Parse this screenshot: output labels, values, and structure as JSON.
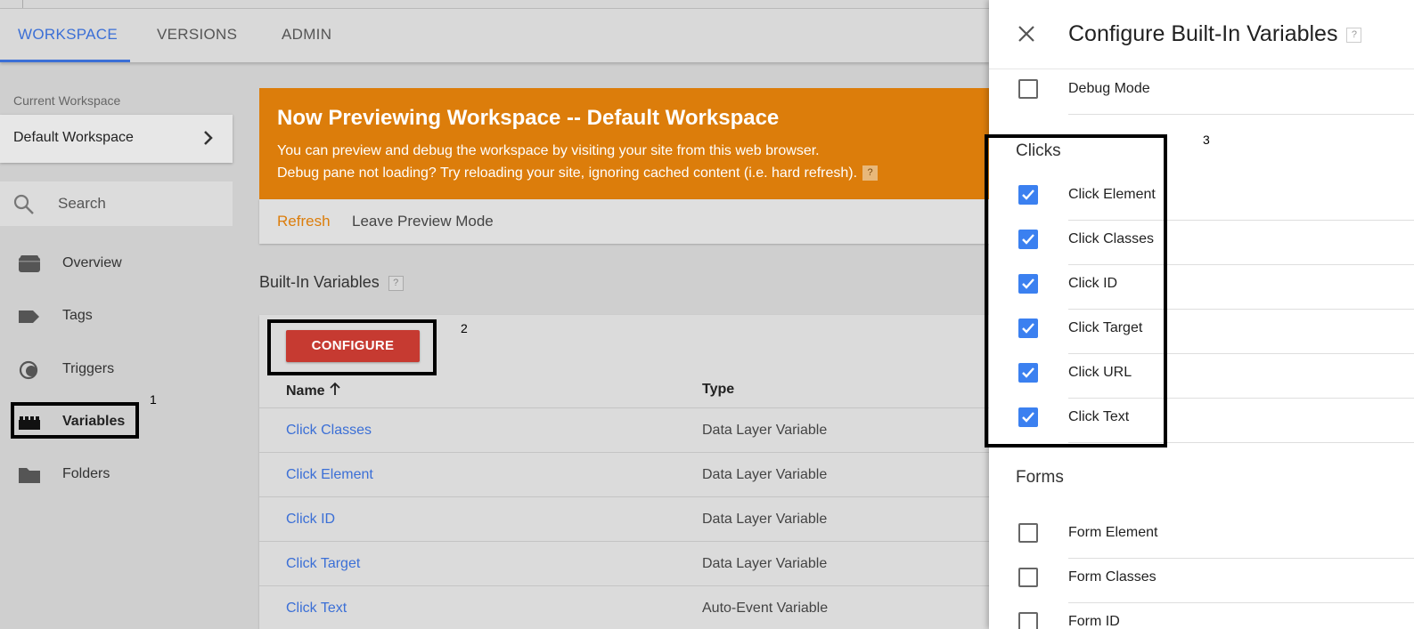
{
  "tabs": {
    "workspace": "WORKSPACE",
    "versions": "VERSIONS",
    "admin": "ADMIN"
  },
  "sidebar": {
    "workspace_label": "Current Workspace",
    "workspace_name": "Default Workspace",
    "search_placeholder": "Search",
    "items": [
      {
        "label": "Overview",
        "icon": "folder-overview-icon"
      },
      {
        "label": "Tags",
        "icon": "tag-icon"
      },
      {
        "label": "Triggers",
        "icon": "trigger-icon"
      },
      {
        "label": "Variables",
        "icon": "variables-icon"
      },
      {
        "label": "Folders",
        "icon": "folder-icon"
      }
    ]
  },
  "banner": {
    "title": "Now Previewing Workspace -- Default Workspace",
    "line1": "You can preview and debug the workspace by visiting your site from this web browser.",
    "line2": "Debug pane not loading? Try reloading your site, ignoring cached content (i.e. hard refresh).",
    "help": "?",
    "refresh": "Refresh",
    "leave": "Leave Preview Mode",
    "color": "#dc7d0b"
  },
  "builtin": {
    "title": "Built-In Variables",
    "help": "?",
    "configure": "CONFIGURE",
    "col_name": "Name",
    "col_type": "Type",
    "rows": [
      {
        "name": "Click Classes",
        "type": "Data Layer Variable"
      },
      {
        "name": "Click Element",
        "type": "Data Layer Variable"
      },
      {
        "name": "Click ID",
        "type": "Data Layer Variable"
      },
      {
        "name": "Click Target",
        "type": "Data Layer Variable"
      },
      {
        "name": "Click Text",
        "type": "Auto-Event Variable"
      }
    ]
  },
  "annotations": {
    "one": "1",
    "two": "2",
    "three": "3"
  },
  "panel": {
    "title": "Configure Built-In Variables",
    "help": "?",
    "debug": {
      "label": "Debug Mode",
      "checked": false
    },
    "clicks_title": "Clicks",
    "clicks": [
      {
        "label": "Click Element",
        "checked": true
      },
      {
        "label": "Click Classes",
        "checked": true
      },
      {
        "label": "Click ID",
        "checked": true
      },
      {
        "label": "Click Target",
        "checked": true
      },
      {
        "label": "Click URL",
        "checked": true
      },
      {
        "label": "Click Text",
        "checked": true
      }
    ],
    "forms_title": "Forms",
    "forms": [
      {
        "label": "Form Element",
        "checked": false
      },
      {
        "label": "Form Classes",
        "checked": false
      },
      {
        "label": "Form ID",
        "checked": false
      }
    ]
  },
  "colors": {
    "accent": "#3b6fd6",
    "configure": "#c63a31",
    "checkbox": "#3b80f0"
  }
}
